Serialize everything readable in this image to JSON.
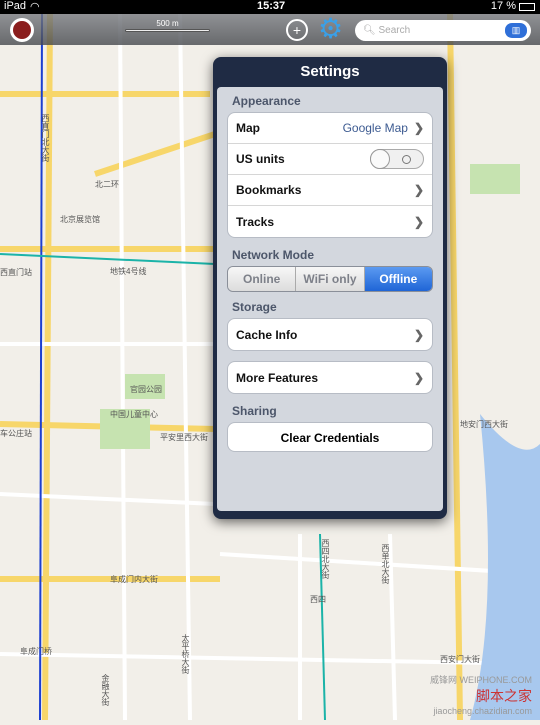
{
  "status": {
    "device": "iPad",
    "time": "15:37",
    "battery": "17 %"
  },
  "toolbar": {
    "scale": "500 m",
    "search_placeholder": "Search"
  },
  "settings": {
    "title": "Settings",
    "appearance": {
      "header": "Appearance",
      "map_label": "Map",
      "map_value": "Google Map",
      "us_units": "US units",
      "us_units_on": false,
      "bookmarks": "Bookmarks",
      "tracks": "Tracks"
    },
    "network": {
      "header": "Network Mode",
      "options": [
        "Online",
        "WiFi only",
        "Offline"
      ],
      "selected": "Offline"
    },
    "storage": {
      "header": "Storage",
      "cache": "Cache Info"
    },
    "more": "More Features",
    "sharing": {
      "header": "Sharing",
      "clear": "Clear Credentials"
    }
  },
  "map": {
    "labels": [
      "西直门北大街",
      "北二环",
      "地铁4号线",
      "西直门站",
      "平安里西大街",
      "阜成门内大街",
      "西四",
      "西单北大街",
      "太平桥大街",
      "西安门大街",
      "车公庄站",
      "北京展览馆",
      "中国儿童中心",
      "官园公园",
      "西四北大街",
      "地安门西大街",
      "阜成门桥",
      "金融大街"
    ]
  },
  "watermark": {
    "site": "威锋网 WEIPHONE.COM",
    "brand": "脚本之家",
    "url": "jiaocheng.chazidian.com"
  },
  "colors": {
    "accent": "#1f65d6",
    "popover": "#1f2b44"
  }
}
